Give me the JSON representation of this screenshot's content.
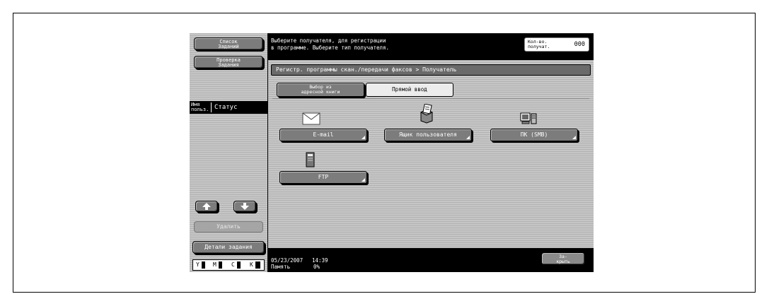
{
  "sidebar": {
    "job_list_label": [
      "Список",
      "Заданий"
    ],
    "job_check_label": [
      "Проверка",
      "Задания"
    ],
    "col_user_label": [
      "Имя",
      "польз."
    ],
    "col_status_label": "Статус",
    "up_arrow_icon": "arrow-up-icon",
    "down_arrow_icon": "arrow-down-icon",
    "delete_label": "Удалить",
    "job_details_label": "Детали задания",
    "toner": [
      "Y",
      "M",
      "C",
      "K"
    ]
  },
  "header": {
    "message_line1": "Выберите получателя, для регистрации",
    "message_line2": "в программе. Выберите тип получателя.",
    "recipients_label": [
      "Кол-во.",
      "получат."
    ],
    "recipients_count": "000"
  },
  "main": {
    "breadcrumb": "Регистр. программы скан./передачи факсов > Получатель",
    "tabs": [
      {
        "label": [
          "Выбор из",
          "адресной книги"
        ]
      },
      {
        "label": [
          "Прямой ввод"
        ]
      }
    ],
    "destinations": [
      {
        "label": "E-mail",
        "icon": "envelope-icon"
      },
      {
        "label": "Ящик пользователя",
        "icon": "user-box-icon"
      },
      {
        "label": "ПК (SMB)",
        "icon": "computer-icon"
      },
      {
        "label": "FTP",
        "icon": "server-icon"
      }
    ]
  },
  "footer": {
    "date": "05/23/2007",
    "time": "14:39",
    "memory_label": "Память",
    "memory_value": "0%",
    "close_label": [
      "За-",
      "крыть"
    ]
  },
  "colors": {
    "screen_bg": "#c6c6c6",
    "button": "#7c7c7c",
    "bar": "#000000"
  }
}
